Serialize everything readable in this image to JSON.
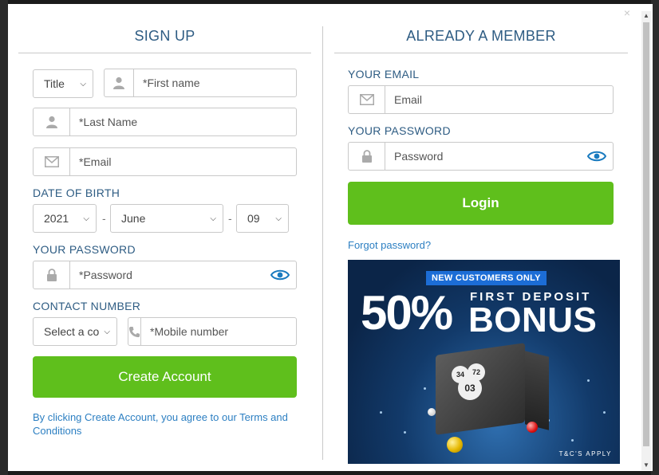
{
  "signup": {
    "heading": "SIGN UP",
    "title_select": "Title",
    "first_name_placeholder": "*First name",
    "last_name_placeholder": "*Last Name",
    "email_placeholder": "*Email",
    "dob_label": "DATE OF BIRTH",
    "dob_year": "2021",
    "dob_month": "June",
    "dob_day": "09",
    "password_label": "YOUR PASSWORD",
    "password_placeholder": "*Password",
    "contact_label": "CONTACT NUMBER",
    "country_select": "Select a co",
    "mobile_placeholder": "*Mobile number",
    "create_button": "Create Account",
    "terms_text": "By clicking Create Account, you agree to our Terms and Conditions",
    "dash": "-"
  },
  "member": {
    "heading": "ALREADY A MEMBER",
    "email_label": "YOUR EMAIL",
    "email_placeholder": "Email",
    "password_label": "YOUR PASSWORD",
    "password_placeholder": "Password",
    "login_button": "Login",
    "forgot_link": "Forgot password?"
  },
  "promo": {
    "badge": "NEW CUSTOMERS ONLY",
    "percent": "50%",
    "first_deposit": "FIRST DEPOSIT",
    "bonus": "BONUS",
    "terms": "T&C'S APPLY",
    "ball_numbers": [
      "34",
      "72",
      "03"
    ]
  },
  "close_glyph": "×",
  "colors": {
    "accent": "#2e5c83",
    "button_green": "#5fbf1c",
    "link": "#2c7fc2",
    "eye": "#1a7bbf"
  }
}
